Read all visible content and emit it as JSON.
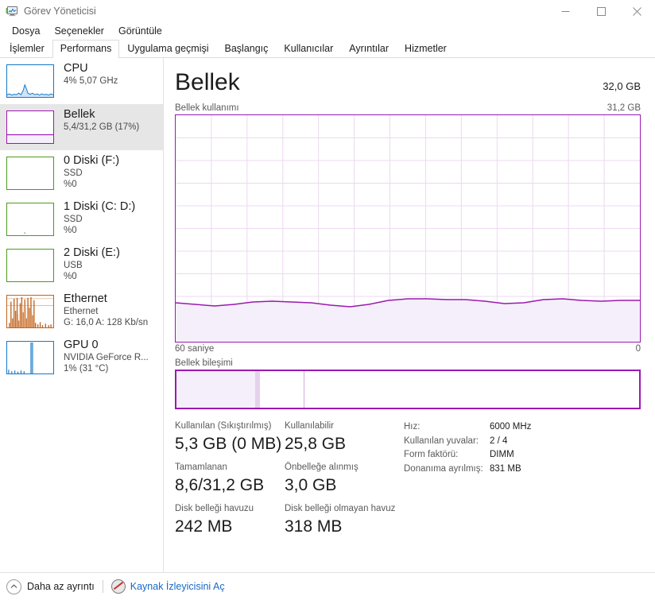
{
  "window": {
    "title": "Görev Yöneticisi",
    "icon": "task-manager-icon",
    "minimize": "minimize-icon",
    "maximize": "maximize-icon",
    "close": "close-icon"
  },
  "menubar": {
    "items": [
      {
        "label": "Dosya"
      },
      {
        "label": "Seçenekler"
      },
      {
        "label": "Görüntüle"
      }
    ]
  },
  "tabs": [
    {
      "label": "İşlemler",
      "selected": false
    },
    {
      "label": "Performans",
      "selected": true
    },
    {
      "label": "Uygulama geçmişi",
      "selected": false
    },
    {
      "label": "Başlangıç",
      "selected": false
    },
    {
      "label": "Kullanıcılar",
      "selected": false
    },
    {
      "label": "Ayrıntılar",
      "selected": false
    },
    {
      "label": "Hizmetler",
      "selected": false
    }
  ],
  "sidebar": {
    "items": [
      {
        "name": "cpu",
        "title": "CPU",
        "line2": "4%  5,07 GHz",
        "line3": "",
        "color": "#1578c8",
        "selected": false
      },
      {
        "name": "memory",
        "title": "Bellek",
        "line2": "5,4/31,2 GB (17%)",
        "line3": "",
        "color": "#9b19b0",
        "selected": true
      },
      {
        "name": "disk-0",
        "title": "0 Diski (F:)",
        "line2": "SSD",
        "line3": "%0",
        "color": "#4a9b1c",
        "selected": false
      },
      {
        "name": "disk-1",
        "title": "1 Diski (C: D:)",
        "line2": "SSD",
        "line3": "%0",
        "color": "#4a9b1c",
        "selected": false
      },
      {
        "name": "disk-2",
        "title": "2 Diski (E:)",
        "line2": "USB",
        "line3": "%0",
        "color": "#4a9b1c",
        "selected": false
      },
      {
        "name": "ethernet",
        "title": "Ethernet",
        "line2": "Ethernet",
        "line3": "G: 16,0  A: 128 Kb/sn",
        "color": "#c0641e",
        "selected": false
      },
      {
        "name": "gpu-0",
        "title": "GPU 0",
        "line2": "NVIDIA GeForce R...",
        "line3": "1%  (31 °C)",
        "color": "#1578c8",
        "selected": false
      }
    ]
  },
  "main": {
    "title": "Bellek",
    "capacity": "32,0 GB",
    "graph_label": "Bellek kullanımı",
    "graph_max_label": "31,2 GB",
    "axis_left": "60 saniye",
    "axis_right": "0",
    "composition_label": "Bellek bileşimi",
    "stats_left": [
      {
        "label": "Kullanılan (Sıkıştırılmış)",
        "value": "5,3 GB (0 MB)"
      },
      {
        "label": "Kullanılabilir",
        "value": "25,8 GB"
      },
      {
        "label": "Tamamlanan",
        "value": "8,6/31,2 GB"
      },
      {
        "label": "Önbelleğe alınmış",
        "value": "3,0 GB"
      },
      {
        "label": "Disk belleği havuzu",
        "value": "242 MB"
      },
      {
        "label": "Disk belleği olmayan havuz",
        "value": "318 MB"
      }
    ],
    "stats_right": [
      {
        "label": "Hız:",
        "value": "6000 MHz"
      },
      {
        "label": "Kullanılan yuvalar:",
        "value": "2 / 4"
      },
      {
        "label": "Form faktörü:",
        "value": "DIMM"
      },
      {
        "label": "Donanıma ayrılmış:",
        "value": "831 MB"
      }
    ]
  },
  "footer": {
    "fewer_details": "Daha az ayrıntı",
    "resource_monitor": "Kaynak İzleyicisini Aç",
    "chevron_icon": "chevron-up-icon",
    "resource_monitor_icon": "resource-monitor-icon"
  },
  "chart_data": {
    "type": "area",
    "title": "Bellek kullanımı",
    "ylabel": "GB",
    "xlabel": "60 saniye",
    "ylim": [
      0,
      31.2
    ],
    "xlim": [
      60,
      0
    ],
    "grid": true,
    "accent_color": "#9b19b0",
    "fill_color": "#f4effa",
    "current_percent": 17,
    "x": [
      60,
      57,
      55,
      53,
      50,
      48,
      45,
      43,
      40,
      38,
      35,
      33,
      30,
      28,
      25,
      23,
      20,
      18,
      15,
      13,
      10,
      8,
      5,
      3,
      0
    ],
    "values": [
      5.35,
      5.3,
      5.22,
      5.28,
      5.36,
      5.38,
      5.36,
      5.33,
      5.25,
      5.2,
      5.28,
      5.4,
      5.45,
      5.45,
      5.44,
      5.43,
      5.38,
      5.3,
      5.34,
      5.42,
      5.46,
      5.4,
      5.38,
      5.4,
      5.4
    ],
    "composition": {
      "type": "bar",
      "segments": [
        {
          "name": "in-use",
          "percent": 17.0,
          "color": "#f4effa"
        },
        {
          "name": "modified",
          "percent": 1.1,
          "color": "#e4d2ec"
        },
        {
          "name": "standby",
          "percent": 9.6,
          "color": "#ffffff"
        },
        {
          "name": "free",
          "percent": 72.3,
          "color": "#ffffff"
        }
      ]
    }
  }
}
